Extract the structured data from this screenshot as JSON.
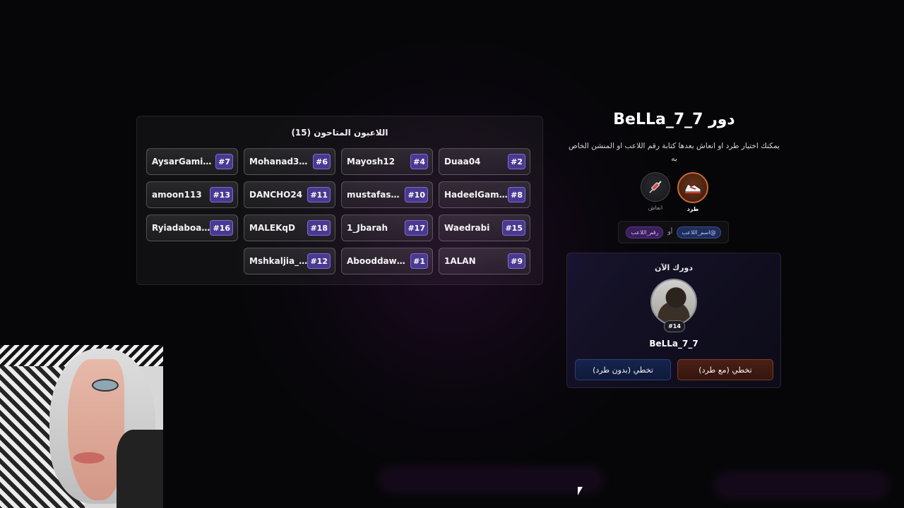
{
  "players_panel": {
    "title": "اللاعبون المتاحون (15)",
    "rows": [
      [
        {
          "name": "Duaa04",
          "number": "#2"
        },
        {
          "name": "Mayosh12",
          "number": "#4"
        },
        {
          "name": "Mohanad338...",
          "number": "#6"
        },
        {
          "name": "AysarGamin...",
          "number": "#7"
        }
      ],
      [
        {
          "name": "HadeelGami...",
          "number": "#8"
        },
        {
          "name": "mustafasha...",
          "number": "#10"
        },
        {
          "name": "DANCHO24",
          "number": "#11"
        },
        {
          "name": "amoon113",
          "number": "#13"
        }
      ],
      [
        {
          "name": "Waedrabi",
          "number": "#15"
        },
        {
          "name": "1_Jbarah",
          "number": "#17"
        },
        {
          "name": "MALEKqD",
          "number": "#18"
        },
        {
          "name": "Ryiadaboam...",
          "number": "#16"
        }
      ],
      [
        {
          "name": "1ALAN",
          "number": "#9"
        },
        {
          "name": "Abooddawoo...",
          "number": "#1"
        },
        {
          "name": "Mshkaljia_...",
          "number": "#12"
        }
      ]
    ]
  },
  "turn": {
    "title": "دور BeLLa_7_7",
    "description": "يمكنك اختيار طرد او انعاش بعدها كتابة رقم اللاعب او المنشن الخاص به"
  },
  "actions": {
    "kick_label": "طرد",
    "kick_icon": "sneaker-icon",
    "revive_label": "انعاش",
    "revive_icon": "syringe-icon"
  },
  "hint": {
    "mention_pill": "@اسم_اللاعب",
    "or_text": "أو",
    "number_pill": "رقم_اللاعب"
  },
  "current": {
    "label": "دورك الآن",
    "badge": "#14",
    "name": "BeLLa_7_7",
    "skip_with_kick": "تخطي (مع طرد)",
    "skip_without_kick": "تخطي (بدون طرد)"
  },
  "colors": {
    "number_badge_bg": "#4a3990",
    "kick_border": "#c7683a",
    "skip_kick_bg": "#4a2016",
    "skip_nokick_bg": "#16244e"
  }
}
